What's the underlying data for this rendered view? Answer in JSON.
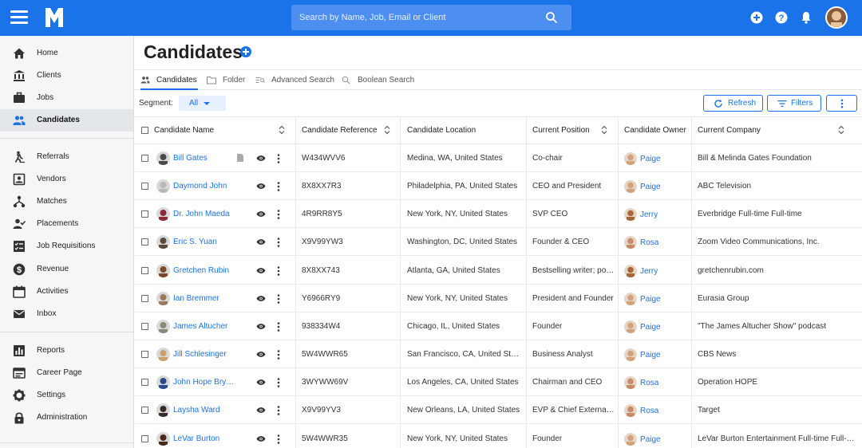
{
  "colors": {
    "brand": "#1a73e8",
    "sidebar_bg": "#f5f6f7",
    "active_bg": "#e4e7ea"
  },
  "header": {
    "search_placeholder": "Search by Name, Job, Email or Client",
    "icons": [
      "menu-icon",
      "logo",
      "search-icon",
      "add-circle-icon",
      "help-icon",
      "notification-bell-icon",
      "user-avatar"
    ]
  },
  "sidebar": {
    "items": [
      {
        "label": "Home",
        "icon": "home-icon"
      },
      {
        "label": "Clients",
        "icon": "bank-icon"
      },
      {
        "label": "Jobs",
        "icon": "briefcase-icon"
      },
      {
        "label": "Candidates",
        "icon": "people-icon",
        "active": true
      },
      {
        "label": "Referrals",
        "icon": "walking-person-icon"
      },
      {
        "label": "Vendors",
        "icon": "contact-box-icon"
      },
      {
        "label": "Matches",
        "icon": "share-tree-icon"
      },
      {
        "label": "Placements",
        "icon": "person-check-icon"
      },
      {
        "label": "Job Requisitions",
        "icon": "checklist-icon"
      },
      {
        "label": "Revenue",
        "icon": "dollar-circle-icon"
      },
      {
        "label": "Activities",
        "icon": "calendar-icon"
      },
      {
        "label": "Inbox",
        "icon": "mail-icon"
      },
      {
        "label": "Reports",
        "icon": "bar-chart-icon"
      },
      {
        "label": "Career Page",
        "icon": "web-page-icon"
      },
      {
        "label": "Settings",
        "icon": "gear-icon"
      },
      {
        "label": "Administration",
        "icon": "lock-icon"
      }
    ]
  },
  "main": {
    "title": "Candidates",
    "tabs": [
      {
        "label": "Candidates",
        "icon": "people-icon",
        "active": true
      },
      {
        "label": "Folder",
        "icon": "folder-icon"
      },
      {
        "label": "Advanced Search",
        "icon": "advanced-search-icon"
      },
      {
        "label": "Boolean Search",
        "icon": "search-icon"
      }
    ],
    "segment": {
      "label": "Segment:",
      "value": "All"
    },
    "buttons": {
      "refresh": "Refresh",
      "filters": "Filters"
    }
  },
  "table": {
    "columns": [
      "Candidate Name",
      "Candidate Reference",
      "Candidate Location",
      "Current Position",
      "Candidate Owner",
      "Current Company"
    ],
    "rows": [
      {
        "name": "Bill Gates",
        "ref": "W434WVV6",
        "location": "Medina, WA, United States",
        "position": "Co-chair",
        "owner": "Paige",
        "company": "Bill & Melinda Gates Foundation",
        "has_doc": true,
        "avatar": "#4a4a4a",
        "owner_avatar": "#d2a27d"
      },
      {
        "name": "Daymond John",
        "ref": "8X8XX7R3",
        "location": "Philadelphia, PA, United States",
        "position": "CEO and President",
        "owner": "Paige",
        "company": "ABC Television",
        "avatar": "#b8b8b8",
        "owner_avatar": "#d2a27d"
      },
      {
        "name": "Dr. John Maeda",
        "ref": "4R9RR8Y5",
        "location": "New York, NY, United States",
        "position": "SVP CEO",
        "owner": "Jerry",
        "company": "Everbridge Full-time Full-time",
        "avatar": "#8b2a3a",
        "owner_avatar": "#a8663a"
      },
      {
        "name": "Eric S. Yuan",
        "ref": "X9V99YW3",
        "location": "Washington, DC, United States",
        "position": "Founder & CEO",
        "owner": "Rosa",
        "company": "Zoom Video Communications, Inc.",
        "avatar": "#5a4a3a",
        "owner_avatar": "#c78a6a"
      },
      {
        "name": "Gretchen Rubin",
        "ref": "8X8XX743",
        "location": "Atlanta, GA, United States",
        "position": "Bestselling writer; po…",
        "owner": "Jerry",
        "company": "gretchenrubin.com",
        "avatar": "#7a4a2a",
        "owner_avatar": "#a8663a"
      },
      {
        "name": "Ian Bremmer",
        "ref": "Y6966RY9",
        "location": "New York, NY, United States",
        "position": "President and Founder",
        "owner": "Paige",
        "company": "Eurasia Group",
        "avatar": "#9a7a5a",
        "owner_avatar": "#d2a27d"
      },
      {
        "name": "James Altucher",
        "ref": "938334W4",
        "location": "Chicago, IL, United States",
        "position": "Founder",
        "owner": "Paige",
        "company": "\"The James Altucher Show\" podcast",
        "avatar": "#8a8a7a",
        "owner_avatar": "#d2a27d"
      },
      {
        "name": "Jill Schlesinger",
        "ref": "5W4WWR65",
        "location": "San Francisco, CA, United States",
        "position": "Business Analyst",
        "owner": "Paige",
        "company": "CBS News",
        "avatar": "#c9a06a",
        "owner_avatar": "#d2a27d"
      },
      {
        "name": "John Hope Bryant",
        "ref": "3WYWW69V",
        "location": "Los Angeles, CA, United States",
        "position": "Chairman and CEO",
        "owner": "Rosa",
        "company": "Operation HOPE",
        "avatar": "#2a4a8a",
        "owner_avatar": "#c78a6a"
      },
      {
        "name": "Laysha Ward",
        "ref": "X9V99YV3",
        "location": "New Orleans, LA, United States",
        "position": "EVP & Chief External …",
        "owner": "Rosa",
        "company": "Target",
        "avatar": "#3a2a2a",
        "owner_avatar": "#c78a6a"
      },
      {
        "name": "LeVar Burton",
        "ref": "5W4WWR35",
        "location": "New York, NY, United States",
        "position": "Founder",
        "owner": "Paige",
        "company": "LeVar Burton Entertainment Full-time Full-…",
        "avatar": "#4a2a1a",
        "owner_avatar": "#d2a27d"
      }
    ]
  }
}
